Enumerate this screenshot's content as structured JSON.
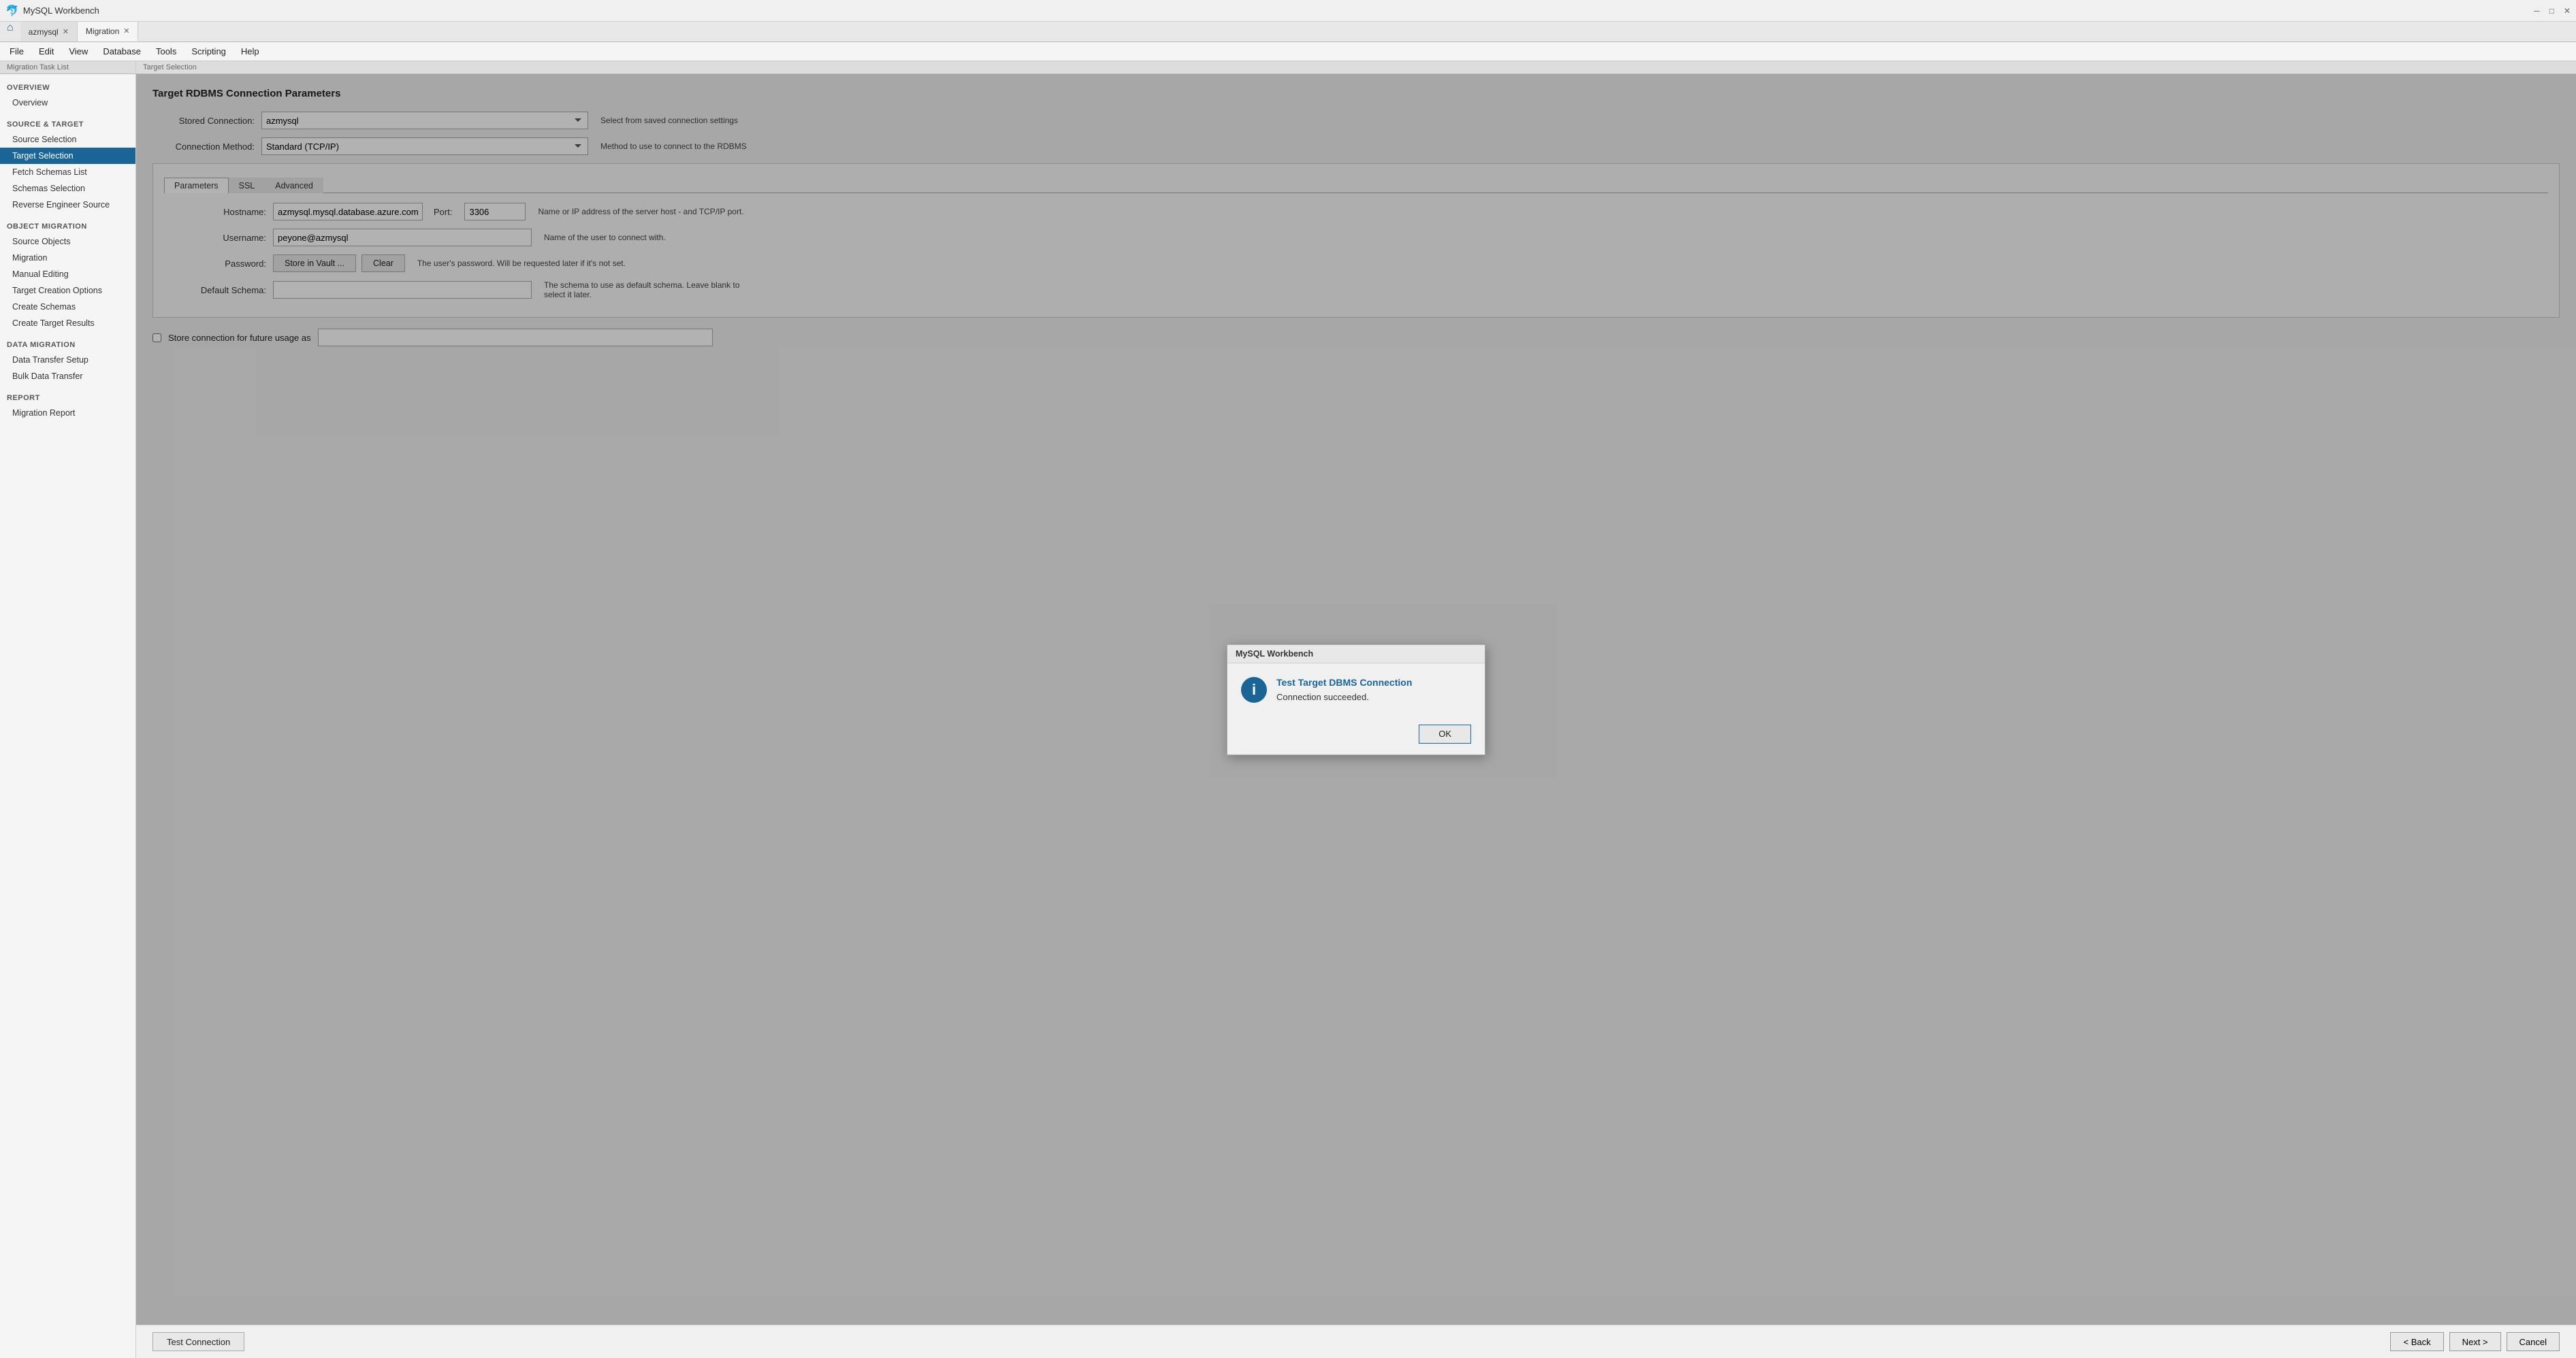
{
  "app": {
    "title": "MySQL Workbench",
    "tabs": [
      {
        "label": "azmysql",
        "active": false,
        "closeable": true
      },
      {
        "label": "Migration",
        "active": true,
        "closeable": true
      }
    ]
  },
  "menu": {
    "items": [
      "File",
      "Edit",
      "View",
      "Database",
      "Tools",
      "Scripting",
      "Help"
    ]
  },
  "sidebar": {
    "label": "Migration Task List",
    "sections": [
      {
        "header": "OVERVIEW",
        "items": [
          {
            "label": "Overview",
            "active": false
          }
        ]
      },
      {
        "header": "SOURCE & TARGET",
        "items": [
          {
            "label": "Source Selection",
            "active": false
          },
          {
            "label": "Target Selection",
            "active": true
          },
          {
            "label": "Fetch Schemas List",
            "active": false
          },
          {
            "label": "Schemas Selection",
            "active": false
          },
          {
            "label": "Reverse Engineer Source",
            "active": false
          }
        ]
      },
      {
        "header": "OBJECT MIGRATION",
        "items": [
          {
            "label": "Source Objects",
            "active": false
          },
          {
            "label": "Migration",
            "active": false
          },
          {
            "label": "Manual Editing",
            "active": false
          },
          {
            "label": "Target Creation Options",
            "active": false
          },
          {
            "label": "Create Schemas",
            "active": false
          },
          {
            "label": "Create Target Results",
            "active": false
          }
        ]
      },
      {
        "header": "DATA MIGRATION",
        "items": [
          {
            "label": "Data Transfer Setup",
            "active": false
          },
          {
            "label": "Bulk Data Transfer",
            "active": false
          }
        ]
      },
      {
        "header": "REPORT",
        "items": [
          {
            "label": "Migration Report",
            "active": false
          }
        ]
      }
    ]
  },
  "content": {
    "breadcrumb": "Target Selection",
    "section_title": "Target RDBMS Connection Parameters",
    "form": {
      "stored_connection_label": "Stored Connection:",
      "stored_connection_value": "azmysql",
      "stored_connection_hint": "Select from saved connection settings",
      "connection_method_label": "Connection Method:",
      "connection_method_value": "Standard (TCP/IP)",
      "connection_method_hint": "Method to use to connect to the RDBMS",
      "tabs": [
        "Parameters",
        "SSL",
        "Advanced"
      ],
      "active_tab": "Parameters",
      "hostname_label": "Hostname:",
      "hostname_value": "azmysql.mysql.database.azure.com",
      "port_label": "Port:",
      "port_value": "3306",
      "hostname_hint": "Name or IP address of the server host - and TCP/IP port.",
      "username_label": "Username:",
      "username_value": "peyone@azmysql",
      "username_hint": "Name of the user to connect with.",
      "password_label": "Password:",
      "store_vault_label": "Store in Vault ...",
      "clear_label": "Clear",
      "password_hint": "The user's password. Will be requested later if it's not set.",
      "default_schema_label": "Default Schema:",
      "default_schema_value": "",
      "default_schema_hint": "The schema to use as default schema. Leave blank to select it later."
    },
    "store_connection": {
      "checkbox_label": "Store connection for future usage as",
      "input_value": ""
    },
    "buttons": {
      "test_connection": "Test Connection",
      "back": "< Back",
      "next": "Next >",
      "cancel": "Cancel"
    }
  },
  "modal": {
    "title": "MySQL Workbench",
    "heading": "Test Target DBMS Connection",
    "description": "Connection succeeded.",
    "ok_label": "OK"
  }
}
